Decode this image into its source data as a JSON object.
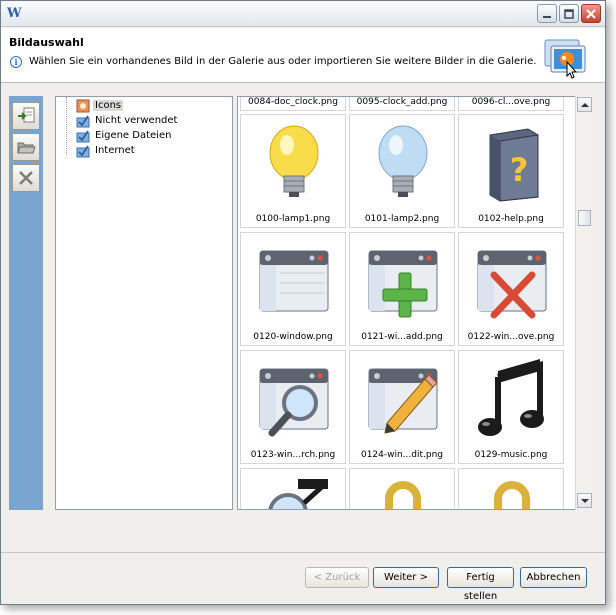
{
  "window": {
    "close_glyph": "✕",
    "minimize_glyph": "–",
    "maximize_glyph": "□"
  },
  "header": {
    "title": "Bildauswahl",
    "description": "Wählen Sie ein vorhandenes Bild in der Galerie aus oder importieren Sie weitere Bilder in die Galerie."
  },
  "tree": {
    "items": [
      {
        "label": "Icons",
        "selected": true
      },
      {
        "label": "Nicht verwendet"
      },
      {
        "label": "Eigene Dateien"
      },
      {
        "label": "Internet"
      }
    ]
  },
  "gallery": {
    "top_captions": [
      "0084-doc_clock.png",
      "0095-clock_add.png",
      "0096-cl...ove.png"
    ],
    "rows": [
      [
        {
          "caption": "0100-lamp1.png",
          "icon": "lightbulb-yellow-icon"
        },
        {
          "caption": "0101-lamp2.png",
          "icon": "lightbulb-blue-icon"
        },
        {
          "caption": "0102-help.png",
          "icon": "help-book-icon"
        }
      ],
      [
        {
          "caption": "0120-window.png",
          "icon": "window-icon"
        },
        {
          "caption": "0121-wi...add.png",
          "icon": "window-add-icon"
        },
        {
          "caption": "0122-win...ove.png",
          "icon": "window-remove-icon"
        }
      ],
      [
        {
          "caption": "0123-win...rch.png",
          "icon": "window-search-icon"
        },
        {
          "caption": "0124-win...dit.png",
          "icon": "window-edit-icon"
        },
        {
          "caption": "0129-music.png",
          "icon": "music-note-icon"
        }
      ]
    ]
  },
  "buttons": {
    "back": "< Zurück",
    "next": "Weiter >",
    "finish": "Fertig stellen",
    "cancel": "Abbrechen"
  },
  "colors": {
    "toolbar": "#7aa5d1",
    "selection": "#d9d9d5",
    "button_border": "#3a66a7"
  }
}
